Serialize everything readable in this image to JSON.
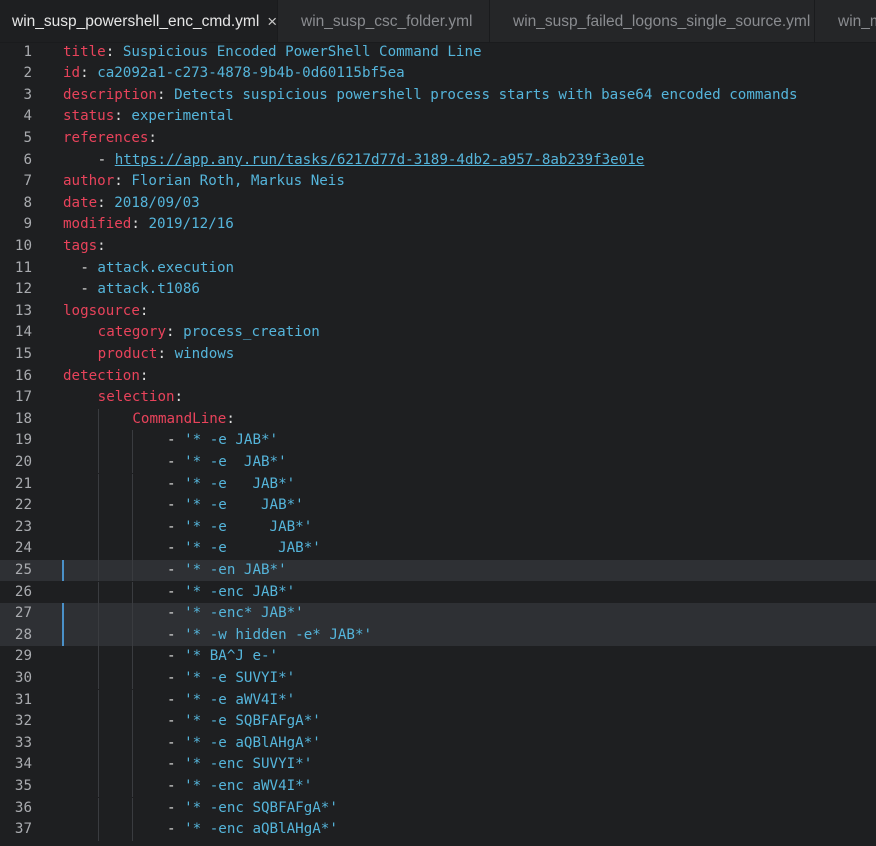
{
  "tabs": [
    {
      "label": "win_susp_powershell_enc_cmd.yml",
      "active": true,
      "close_icon": "×"
    },
    {
      "label": "win_susp_csc_folder.yml",
      "active": false
    },
    {
      "label": "win_susp_failed_logons_single_source.yml",
      "active": false
    },
    {
      "label": "win_ma",
      "active": false
    }
  ],
  "highlight_lines": [
    25,
    27,
    28
  ],
  "lines": [
    {
      "n": "1",
      "indent": 0,
      "key": "title",
      "sep": ": ",
      "value": "Suspicious Encoded PowerShell Command Line"
    },
    {
      "n": "2",
      "indent": 0,
      "key": "id",
      "sep": ": ",
      "value": "ca2092a1-c273-4878-9b4b-0d60115bf5ea"
    },
    {
      "n": "3",
      "indent": 0,
      "key": "description",
      "sep": ": ",
      "value": "Detects suspicious powershell process starts with base64 encoded commands"
    },
    {
      "n": "4",
      "indent": 0,
      "key": "status",
      "sep": ": ",
      "value": "experimental"
    },
    {
      "n": "5",
      "indent": 0,
      "key": "references",
      "sep": ":",
      "value": ""
    },
    {
      "n": "6",
      "indent": 4,
      "dash": "- ",
      "link": "https://app.any.run/tasks/6217d77d-3189-4db2-a957-8ab239f3e01e"
    },
    {
      "n": "7",
      "indent": 0,
      "key": "author",
      "sep": ": ",
      "value": "Florian Roth, Markus Neis"
    },
    {
      "n": "8",
      "indent": 0,
      "key": "date",
      "sep": ": ",
      "value": "2018/09/03"
    },
    {
      "n": "9",
      "indent": 0,
      "key": "modified",
      "sep": ": ",
      "value": "2019/12/16"
    },
    {
      "n": "10",
      "indent": 0,
      "key": "tags",
      "sep": ":",
      "value": ""
    },
    {
      "n": "11",
      "indent": 2,
      "dash": "- ",
      "value": "attack.execution"
    },
    {
      "n": "12",
      "indent": 2,
      "dash": "- ",
      "value": "attack.t1086"
    },
    {
      "n": "13",
      "indent": 0,
      "key": "logsource",
      "sep": ":",
      "value": ""
    },
    {
      "n": "14",
      "indent": 4,
      "key": "category",
      "sep": ": ",
      "value": "process_creation"
    },
    {
      "n": "15",
      "indent": 4,
      "key": "product",
      "sep": ": ",
      "value": "windows"
    },
    {
      "n": "16",
      "indent": 0,
      "key": "detection",
      "sep": ":",
      "value": ""
    },
    {
      "n": "17",
      "indent": 4,
      "key": "selection",
      "sep": ":",
      "value": ""
    },
    {
      "n": "18",
      "indent": 8,
      "key": "CommandLine",
      "sep": ":",
      "value": ""
    },
    {
      "n": "19",
      "indent": 12,
      "dash": "- ",
      "value": "'* -e JAB*'"
    },
    {
      "n": "20",
      "indent": 12,
      "dash": "- ",
      "value": "'* -e  JAB*'"
    },
    {
      "n": "21",
      "indent": 12,
      "dash": "- ",
      "value": "'* -e   JAB*'"
    },
    {
      "n": "22",
      "indent": 12,
      "dash": "- ",
      "value": "'* -e    JAB*'"
    },
    {
      "n": "23",
      "indent": 12,
      "dash": "- ",
      "value": "'* -e     JAB*'"
    },
    {
      "n": "24",
      "indent": 12,
      "dash": "- ",
      "value": "'* -e      JAB*'"
    },
    {
      "n": "25",
      "indent": 12,
      "dash": "- ",
      "value": "'* -en JAB*'"
    },
    {
      "n": "26",
      "indent": 12,
      "dash": "- ",
      "value": "'* -enc JAB*'"
    },
    {
      "n": "27",
      "indent": 12,
      "dash": "- ",
      "value": "'* -enc* JAB*'"
    },
    {
      "n": "28",
      "indent": 12,
      "dash": "- ",
      "value": "'* -w hidden -e* JAB*'"
    },
    {
      "n": "29",
      "indent": 12,
      "dash": "- ",
      "value": "'* BA^J e-'"
    },
    {
      "n": "30",
      "indent": 12,
      "dash": "- ",
      "value": "'* -e SUVYI*'"
    },
    {
      "n": "31",
      "indent": 12,
      "dash": "- ",
      "value": "'* -e aWV4I*'"
    },
    {
      "n": "32",
      "indent": 12,
      "dash": "- ",
      "value": "'* -e SQBFAFgA*'"
    },
    {
      "n": "33",
      "indent": 12,
      "dash": "- ",
      "value": "'* -e aQBlAHgA*'"
    },
    {
      "n": "34",
      "indent": 12,
      "dash": "- ",
      "value": "'* -enc SUVYI*'"
    },
    {
      "n": "35",
      "indent": 12,
      "dash": "- ",
      "value": "'* -enc aWV4I*'"
    },
    {
      "n": "36",
      "indent": 12,
      "dash": "- ",
      "value": "'* -enc SQBFAFgA*'"
    },
    {
      "n": "37",
      "indent": 12,
      "dash": "- ",
      "value": "'* -enc aQBlAHgA*'"
    }
  ]
}
